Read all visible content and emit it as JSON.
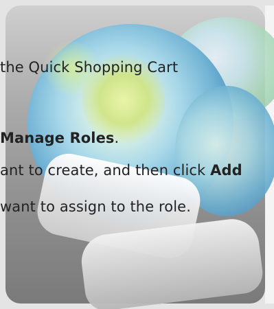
{
  "instructions": {
    "line1": {
      "text": "the Quick Shopping Cart"
    },
    "line2": {
      "bold": "Manage Roles",
      "suffix": "."
    },
    "line3": {
      "prefix": "ant to create, and then click ",
      "bold": "Add"
    },
    "line4": {
      "text": "want to assign to the role."
    }
  },
  "background": {
    "icon": "quick-shopping-cart-globe-icon"
  }
}
